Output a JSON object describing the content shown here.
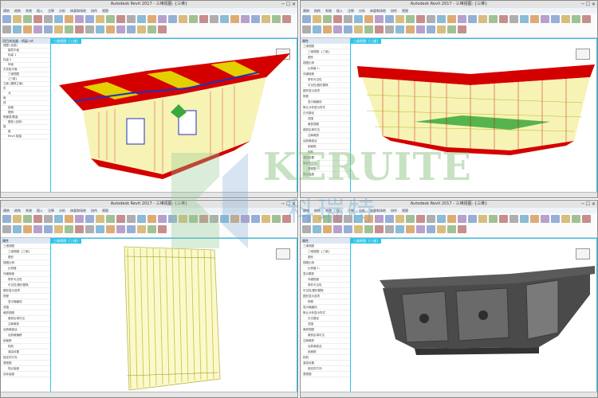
{
  "windows": [
    {
      "id": "q1",
      "title": "Autodesk Revit 2017 - 三维视图: {三维}",
      "view_tab": "三维视图: {三维}",
      "panel_title": "项目浏览器 - 桥梁.rvt",
      "panel_items": [
        "视图 (全部)",
        "楼层平面",
        "标高 1",
        "标高 2",
        "场地",
        "天花板平面",
        "三维视图",
        "{三维}",
        "立面 (建筑立面)",
        "东",
        "北",
        "南",
        "西",
        "剖面",
        "图例",
        "明细表/数量",
        "图纸 (全部)",
        "族",
        "组",
        "Revit 链接"
      ]
    },
    {
      "id": "q2",
      "title": "Autodesk Revit 2017 - 三维视图: {三维}",
      "view_tab": "三维视图: {三维}",
      "panel_title": "属性",
      "panel_items": [
        "三维视图",
        "三维视图: {三维}",
        "图形",
        "视图比例",
        "比例值 1:",
        "详细程度",
        "零件可见性",
        "可见性/图形替换",
        "图形显示选项",
        "规程",
        "显示隐藏线",
        "默认分析显示样式",
        "日光路径",
        "范围",
        "裁剪视图",
        "裁剪区域可见",
        "注释裁剪",
        "远剪裁激活",
        "剖面框",
        "相机",
        "渲染设置",
        "锁定的方向",
        "透视图",
        "视点高度"
      ]
    },
    {
      "id": "q3",
      "title": "Autodesk Revit 2017 - 三维视图: {三维}",
      "view_tab": "三维视图: {三维}",
      "panel_title": "属性",
      "panel_items": [
        "三维视图",
        "三维视图: {三维}",
        "图形",
        "视图比例",
        "比例值",
        "详细程度",
        "零件可见性",
        "可见性/图形替换",
        "图形显示选项",
        "规程",
        "显示隐藏线",
        "范围",
        "裁剪视图",
        "裁剪区域可见",
        "注释裁剪",
        "远剪裁激活",
        "远剪裁偏移",
        "剖面框",
        "相机",
        "渲染设置",
        "锁定的方向",
        "透视图",
        "视点高度",
        "目标高度"
      ]
    },
    {
      "id": "q4",
      "title": "Autodesk Revit 2017 - 三维视图: {三维}",
      "view_tab": "三维视图: {三维}",
      "panel_title": "属性",
      "panel_items": [
        "三维视图",
        "三维视图: {三维}",
        "图形",
        "视图比例",
        "比例值 1:",
        "显示模型",
        "详细程度",
        "零件可见性",
        "可见性/图形替换",
        "图形显示选项",
        "规程",
        "显示隐藏线",
        "默认分析显示样式",
        "日光路径",
        "范围",
        "裁剪视图",
        "裁剪区域可见",
        "注释裁剪",
        "远剪裁激活",
        "剖面框",
        "相机",
        "渲染设置",
        "锁定的方向",
        "透视图"
      ]
    }
  ],
  "ribbon_tabs": [
    "建筑",
    "结构",
    "系统",
    "插入",
    "注释",
    "分析",
    "体量和场地",
    "协作",
    "视图",
    "管理",
    "附加模块",
    "修改"
  ],
  "watermark": {
    "latin": "KERUITE",
    "cjk": "科瑞特"
  },
  "colors": {
    "accent": "#2ec4e8",
    "rebar_red": "#d40000",
    "rebar_yellow": "#e6e600",
    "rebar_green": "#3aa83a",
    "rebar_blue": "#2030c0",
    "concrete": "#4a4a4a"
  }
}
